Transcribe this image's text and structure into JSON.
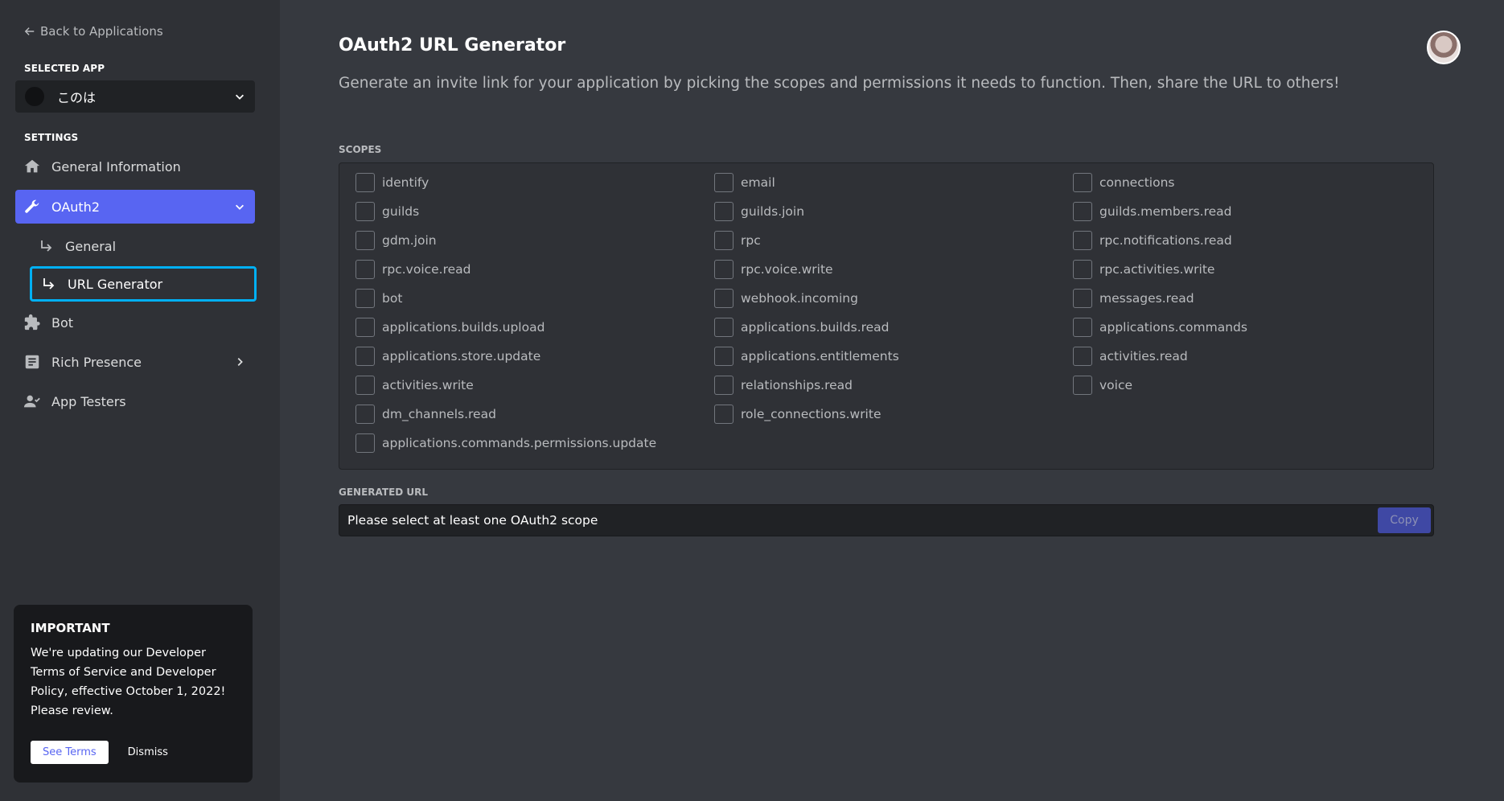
{
  "sidebar": {
    "back_label": "Back to Applications",
    "selected_app_label": "SELECTED APP",
    "selected_app_name": "このは",
    "settings_label": "SETTINGS",
    "items": {
      "general_information": "General Information",
      "oauth2": "OAuth2",
      "oauth2_general": "General",
      "url_generator": "URL Generator",
      "bot": "Bot",
      "rich_presence": "Rich Presence",
      "app_testers": "App Testers"
    }
  },
  "notice": {
    "title": "IMPORTANT",
    "body": "We're updating our Developer Terms of Service and Developer Policy, effective October 1, 2022! Please review.",
    "see_terms": "See Terms",
    "dismiss": "Dismiss"
  },
  "main": {
    "title": "OAuth2 URL Generator",
    "description": "Generate an invite link for your application by picking the scopes and permissions it needs to function. Then, share the URL to others!",
    "scopes_label": "SCOPES",
    "scopes": [
      [
        "identify",
        "email",
        "connections"
      ],
      [
        "guilds",
        "guilds.join",
        "guilds.members.read"
      ],
      [
        "gdm.join",
        "rpc",
        "rpc.notifications.read"
      ],
      [
        "rpc.voice.read",
        "rpc.voice.write",
        "rpc.activities.write"
      ],
      [
        "bot",
        "webhook.incoming",
        "messages.read"
      ],
      [
        "applications.builds.upload",
        "applications.builds.read",
        "applications.commands"
      ],
      [
        "applications.store.update",
        "applications.entitlements",
        "activities.read"
      ],
      [
        "activities.write",
        "relationships.read",
        "voice"
      ],
      [
        "dm_channels.read",
        "role_connections.write"
      ],
      [
        "applications.commands.permissions.update"
      ]
    ],
    "generated_url_label": "GENERATED URL",
    "generated_url_value": "Please select at least one OAuth2 scope",
    "copy_label": "Copy"
  },
  "colors": {
    "accent": "#5865f2",
    "focus_ring": "#00b0f4",
    "background": "#36393f",
    "sidebar": "#2f3136"
  }
}
